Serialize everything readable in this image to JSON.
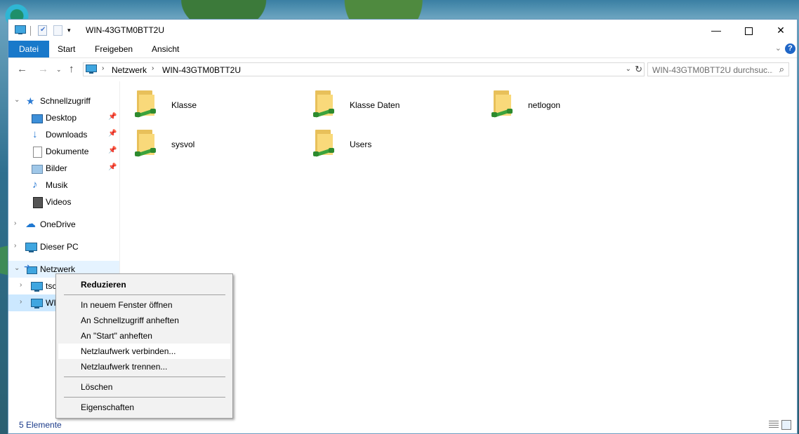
{
  "window": {
    "title": "WIN-43GTM0BTT2U",
    "qa_dropdown": "▾",
    "controls": {
      "min": "—",
      "close": "✕"
    }
  },
  "ribbon": {
    "tabs": [
      "Datei",
      "Start",
      "Freigeben",
      "Ansicht"
    ],
    "expand": "⌄",
    "help": "?"
  },
  "address": {
    "crumbs": [
      "Netzwerk",
      "WIN-43GTM0BTT2U"
    ],
    "sep": "›",
    "dropdown": "⌄",
    "refresh": "↻"
  },
  "search": {
    "placeholder": "WIN-43GTM0BTT2U durchsuc...",
    "icon": "⌕"
  },
  "nav": {
    "back": "←",
    "forward": "→",
    "recent": "⌄",
    "up": "↑",
    "items": [
      {
        "label": "Schnellzugriff",
        "icon": "star-icon",
        "chev": "⌄"
      },
      {
        "label": "Desktop",
        "icon": "desktop-icon",
        "pin": "📌"
      },
      {
        "label": "Downloads",
        "icon": "download-icon",
        "pin": "📌"
      },
      {
        "label": "Dokumente",
        "icon": "document-icon",
        "pin": "📌"
      },
      {
        "label": "Bilder",
        "icon": "pictures-icon",
        "pin": "📌"
      },
      {
        "label": "Musik",
        "icon": "music-icon"
      },
      {
        "label": "Videos",
        "icon": "videos-icon"
      },
      {
        "label": "OneDrive",
        "icon": "cloud-icon",
        "chev": "›"
      },
      {
        "label": "Dieser PC",
        "icon": "pc-icon",
        "chev": "›"
      },
      {
        "label": "Netzwerk",
        "icon": "network-icon",
        "chev": "⌄"
      },
      {
        "label": "tsc",
        "icon": "pc-icon",
        "chev": "›"
      },
      {
        "label": "WI",
        "icon": "pc-icon",
        "chev": "›"
      }
    ]
  },
  "folders": [
    "Klasse",
    "Klasse Daten",
    "netlogon",
    "sysvol",
    "Users"
  ],
  "status": {
    "count": "5 Elemente"
  },
  "context_menu": {
    "items": [
      "Reduzieren",
      "In neuem Fenster öffnen",
      "An Schnellzugriff anheften",
      "An \"Start\" anheften",
      "Netzlaufwerk verbinden...",
      "Netzlaufwerk trennen...",
      "Löschen",
      "Eigenschaften"
    ],
    "highlighted": "Netzlaufwerk verbinden..."
  },
  "colors": {
    "accent": "#1979ca",
    "selection": "#cce8ff",
    "hover": "#e5f3ff"
  }
}
